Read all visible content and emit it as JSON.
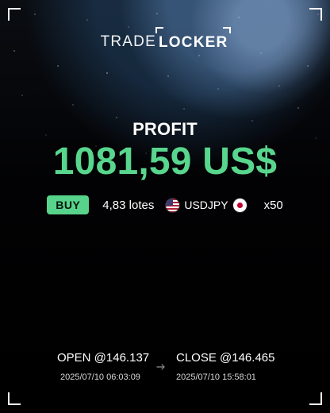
{
  "brand": {
    "trade": "TRADE",
    "locker": "LOCKER"
  },
  "result": {
    "label": "PROFIT",
    "amount": "1081,59 US$",
    "amount_color": "#58d68d"
  },
  "trade": {
    "side": "BUY",
    "size": "4,83 lotes",
    "symbol": "USDJPY",
    "leverage": "x50",
    "badge_color": "#57d38b"
  },
  "prices": {
    "open_label": "OPEN @146.137",
    "open_time": "2025/07/10 06:03:09",
    "close_label": "CLOSE @146.465",
    "close_time": "2025/07/10 15:58:01"
  },
  "icons": {
    "from_flag": "us-flag-icon",
    "to_flag": "jp-flag-icon",
    "arrow": "arrow-right-icon"
  }
}
